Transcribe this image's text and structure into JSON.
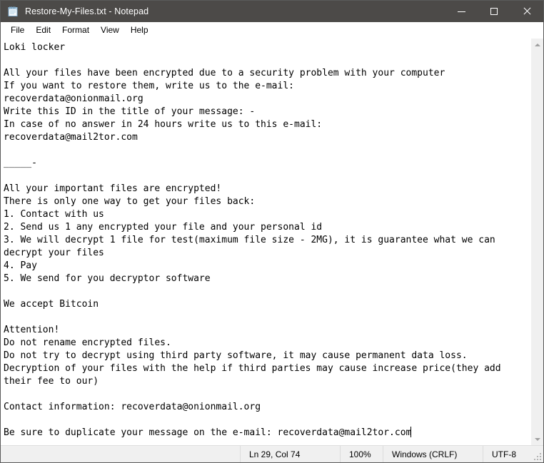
{
  "window": {
    "title": "Restore-My-Files.txt - Notepad",
    "icon": "notepad-icon",
    "controls": {
      "minimize": "minimize-button",
      "maximize": "maximize-button",
      "close": "close-button"
    }
  },
  "menubar": {
    "items": [
      {
        "label": "File"
      },
      {
        "label": "Edit"
      },
      {
        "label": "Format"
      },
      {
        "label": "View"
      },
      {
        "label": "Help"
      }
    ]
  },
  "editor": {
    "text": "Loki locker\n\nAll your files have been encrypted due to a security problem with your computer\nIf you want to restore them, write us to the e-mail:\nrecoverdata@onionmail.org\nWrite this ID in the title of your message: -\nIn case of no answer in 24 hours write us to this e-mail:\nrecoverdata@mail2tor.com\n\n_____-\n\nAll your important files are encrypted!\nThere is only one way to get your files back:\n1. Contact with us\n2. Send us 1 any encrypted your file and your personal id\n3. We will decrypt 1 file for test(maximum file size - 2MG), it is guarantee what we can\ndecrypt your files\n4. Pay\n5. We send for you decryptor software\n\nWe accept Bitcoin\n\nAttention!\nDo not rename encrypted files.\nDo not try to decrypt using third party software, it may cause permanent data loss.\nDecryption of your files with the help if third parties may cause increase price(they add\ntheir fee to our)\n\nContact information: recoverdata@onionmail.org\n\nBe sure to duplicate your message on the e-mail: recoverdata@mail2tor.com"
  },
  "scrollbar": {
    "up_arrow": "scroll-up-arrow",
    "down_arrow": "scroll-down-arrow"
  },
  "statusbar": {
    "line_col": "Ln 29, Col 74",
    "zoom": "100%",
    "line_ending": "Windows (CRLF)",
    "encoding": "UTF-8"
  },
  "colors": {
    "titlebar_bg": "#4c4a48",
    "titlebar_fg": "#ffffff",
    "chrome_bg": "#f0f0f0",
    "editor_bg": "#ffffff",
    "editor_fg": "#000000",
    "window_border": "#5a5a5a"
  }
}
